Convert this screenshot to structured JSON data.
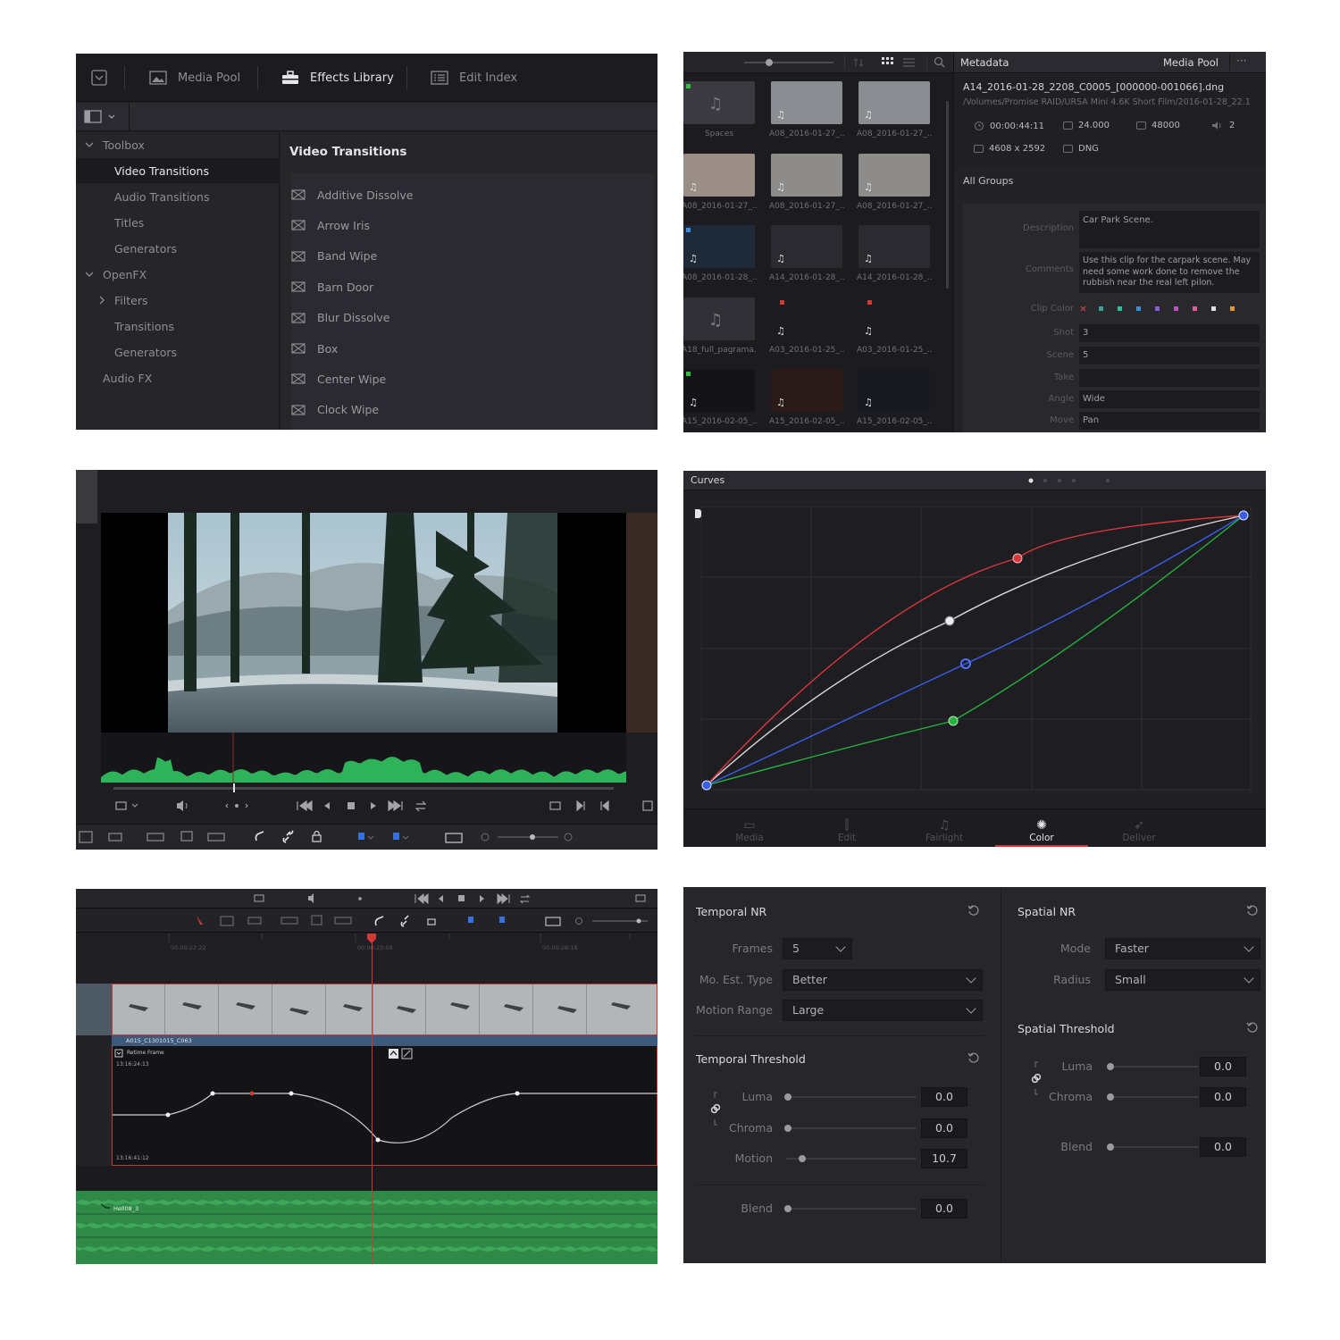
{
  "effects_library": {
    "tabs": [
      {
        "label": "Media Pool"
      },
      {
        "label": "Effects Library"
      },
      {
        "label": "Edit Index"
      }
    ],
    "tree": [
      {
        "label": "Toolbox"
      },
      {
        "label": "Video Transitions"
      },
      {
        "label": "Audio Transitions"
      },
      {
        "label": "Titles"
      },
      {
        "label": "Generators"
      },
      {
        "label": "OpenFX"
      },
      {
        "label": "Filters"
      },
      {
        "label": "Transitions"
      },
      {
        "label": "Generators"
      },
      {
        "label": "Audio FX"
      }
    ],
    "list_title": "Video Transitions",
    "items": [
      "Additive Dissolve",
      "Arrow Iris",
      "Band Wipe",
      "Barn Door",
      "Blur Dissolve",
      "Box",
      "Center Wipe",
      "Clock Wipe"
    ]
  },
  "media_pool": {
    "clips": [
      "Spaces",
      "A08_2016-01-27_...",
      "A08_2016-01-27_...",
      "A08_2016-01-27_...",
      "A08_2016-01-27_...",
      "A08_2016-01-27_...",
      "A08_2016-01-28_...",
      "A14_2016-01-28_...",
      "A14_2016-01-28_...",
      "A18_full_pagrama...",
      "A03_2016-01-25_...",
      "A03_2016-01-25_...",
      "A15_2016-02-05_...",
      "A15_2016-02-05_...",
      "A15_2016-02-05_..."
    ]
  },
  "metadata": {
    "title": "Metadata",
    "source": "Media Pool",
    "more": "···",
    "filename": "A14_2016-01-28_2208_C0005_[000000-001066].dng",
    "path": "/Volumes/Promise RAID/URSA Mini 4.6K Short Film/2016-01-28_22.1",
    "duration": "00:00:44:11",
    "fps": "24.000",
    "audio_rate": "48000",
    "channels": "2",
    "resolution": "4608 x 2592",
    "codec": "DNG",
    "groups": "All Groups",
    "fields": [
      {
        "label": "Description",
        "value": "Car Park Scene."
      },
      {
        "label": "Comments",
        "value": "Use this clip for the carpark scene. May need some work done to remove the rubbish near the real left pilon."
      },
      {
        "label": "Clip Color",
        "value": ""
      },
      {
        "label": "Shot",
        "value": "3"
      },
      {
        "label": "Scene",
        "value": "5"
      },
      {
        "label": "Take",
        "value": ""
      },
      {
        "label": "Angle",
        "value": "Wide"
      },
      {
        "label": "Move",
        "value": "Pan"
      }
    ]
  },
  "curves": {
    "title": "Curves",
    "pages": [
      {
        "label": "Media",
        "icon": "media-icon"
      },
      {
        "label": "Edit",
        "icon": "edit-icon"
      },
      {
        "label": "Fairlight",
        "icon": "music-note-icon"
      },
      {
        "label": "Color",
        "icon": "color-wheel-icon"
      },
      {
        "label": "Deliver",
        "icon": "rocket-icon"
      }
    ],
    "active_page": "Color",
    "colors": {
      "red": "#d8383b",
      "white": "#d9d9dc",
      "blue": "#3a5ee8",
      "green": "#27b13d"
    }
  },
  "timeline": {
    "ruler": [
      "00:00:22:22",
      "00:00:23:08",
      "00:00:28:18"
    ],
    "video_clip": "A015_C1301015_C063",
    "retime_label": "Retime Frame",
    "retime_top": "13:16:24:13",
    "retime_bottom": "13:16:41:12",
    "audio_clip": "Hell08_3"
  },
  "noise_reduction": {
    "temporal": {
      "title": "Temporal NR",
      "frames_label": "Frames",
      "frames_value": "5",
      "mo_est_label": "Mo. Est. Type",
      "mo_est_value": "Better",
      "motion_range_label": "Motion Range",
      "motion_range_value": "Large"
    },
    "temporal_threshold": {
      "title": "Temporal Threshold",
      "luma_label": "Luma",
      "luma_value": "0.0",
      "chroma_label": "Chroma",
      "chroma_value": "0.0",
      "motion_label": "Motion",
      "motion_value": "10.7",
      "blend_label": "Blend",
      "blend_value": "0.0"
    },
    "spatial": {
      "title": "Spatial NR",
      "mode_label": "Mode",
      "mode_value": "Faster",
      "radius_label": "Radius",
      "radius_value": "Small"
    },
    "spatial_threshold": {
      "title": "Spatial Threshold",
      "luma_label": "Luma",
      "luma_value": "0.0",
      "chroma_label": "Chroma",
      "chroma_value": "0.0",
      "blend_label": "Blend",
      "blend_value": "0.0"
    }
  }
}
